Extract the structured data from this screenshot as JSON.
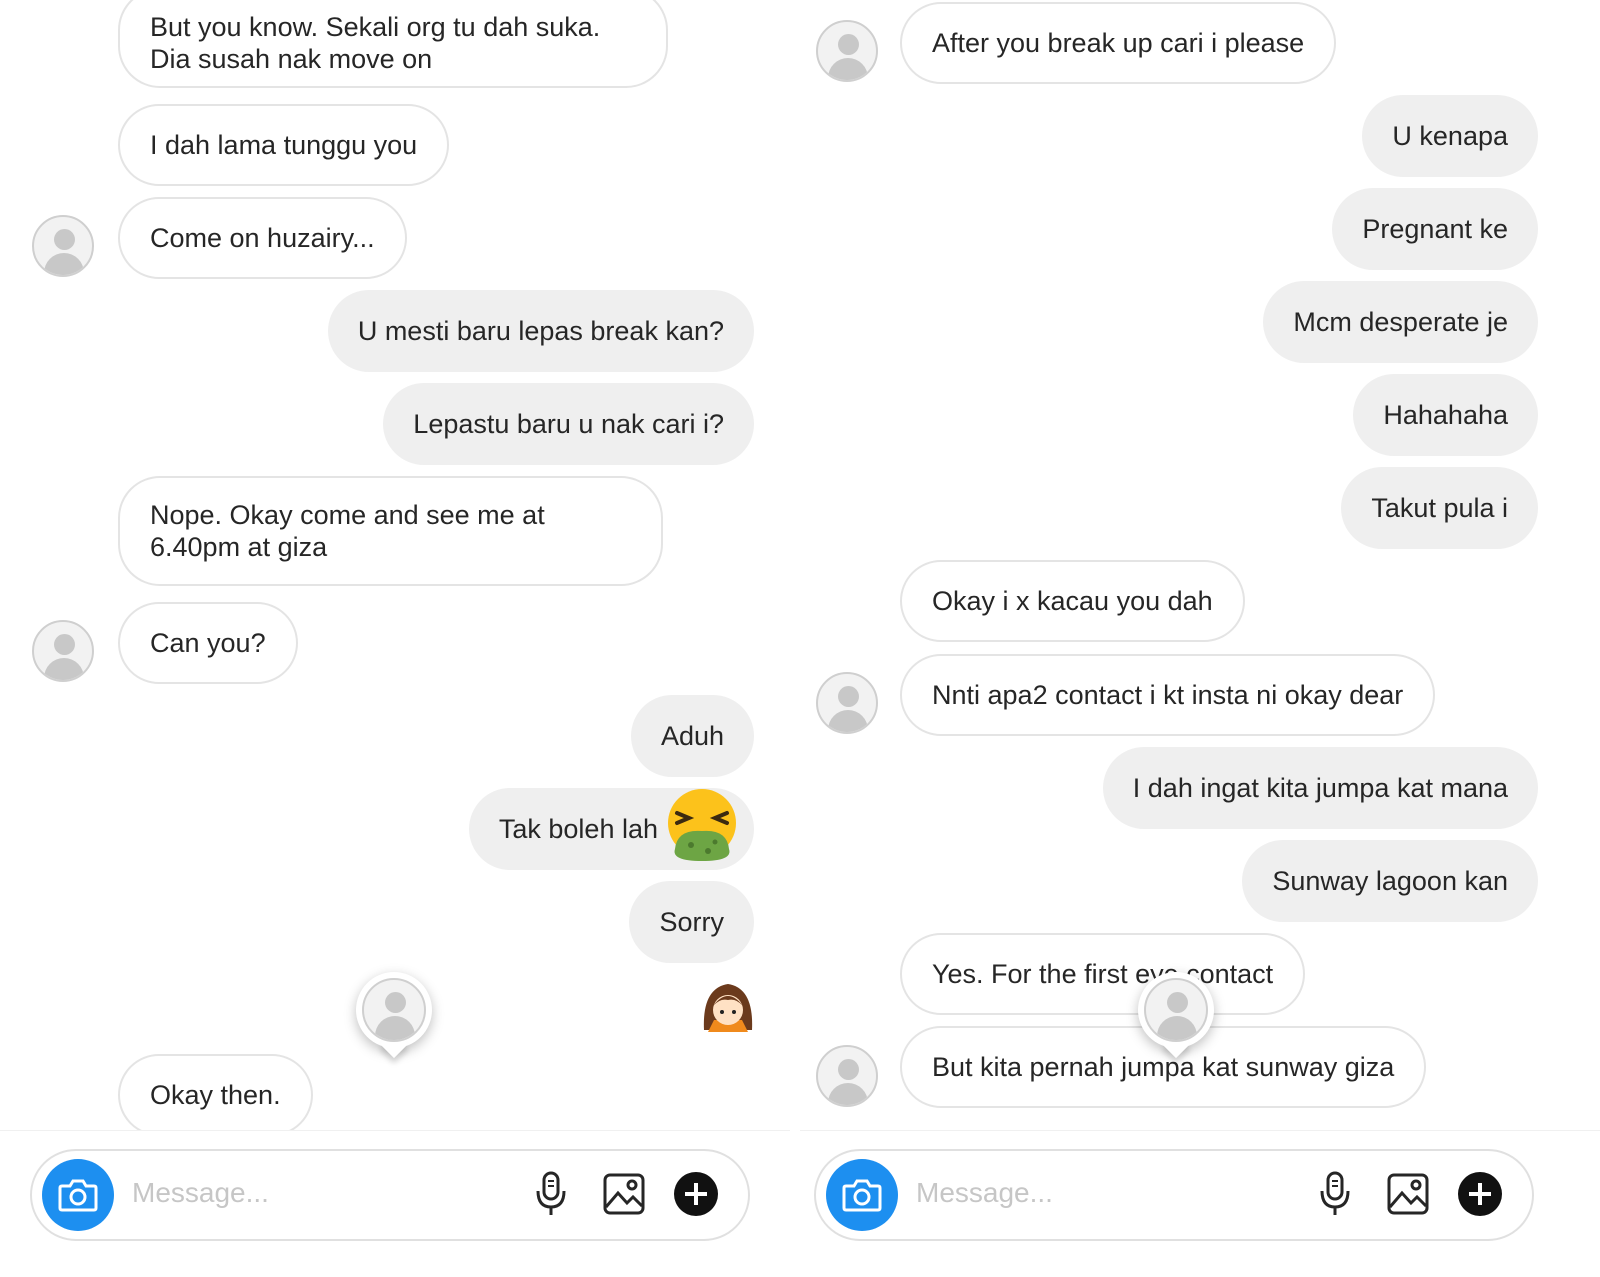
{
  "left": {
    "messages": [
      {
        "text": "But you know. Sekali org tu dah suka. Dia susah nak move on",
        "from": "other"
      },
      {
        "text": "I dah lama tunggu you",
        "from": "other"
      },
      {
        "text": "Come on huzairy...",
        "from": "other"
      },
      {
        "text": "U mesti baru lepas break kan?",
        "from": "me"
      },
      {
        "text": "Lepastu baru u nak cari i?",
        "from": "me"
      },
      {
        "text": "Nope. Okay come and see me at 6.40pm at giza",
        "from": "other"
      },
      {
        "text": "Can you?",
        "from": "other"
      },
      {
        "text": "Aduh",
        "from": "me"
      },
      {
        "text": "Tak boleh lah",
        "from": "me",
        "emoji": "nauseated-face-emoji"
      },
      {
        "text": "Sorry",
        "from": "me"
      },
      {
        "text": "Okay then.",
        "from": "other"
      }
    ],
    "sticker": "girl-sticker",
    "composer": {
      "placeholder": "Message..."
    }
  },
  "right": {
    "messages": [
      {
        "text": "After you break up cari i please",
        "from": "other"
      },
      {
        "text": "U kenapa",
        "from": "me"
      },
      {
        "text": "Pregnant ke",
        "from": "me"
      },
      {
        "text": "Mcm desperate je",
        "from": "me"
      },
      {
        "text": "Hahahaha",
        "from": "me"
      },
      {
        "text": "Takut pula i",
        "from": "me"
      },
      {
        "text": "Okay i x kacau you dah",
        "from": "other"
      },
      {
        "text": "Nnti apa2 contact i kt insta ni okay dear",
        "from": "other"
      },
      {
        "text": "I dah ingat kita jumpa kat mana",
        "from": "me"
      },
      {
        "text": "Sunway lagoon kan",
        "from": "me"
      },
      {
        "text": "Yes. For the first eye contact",
        "from": "other"
      },
      {
        "text": "But kita pernah jumpa kat sunway giza",
        "from": "other"
      }
    ],
    "composer": {
      "placeholder": "Message..."
    }
  },
  "colors": {
    "accent": "#1d8ff0",
    "outgoing_bubble": "#efefef",
    "incoming_border": "#e4e4e4"
  }
}
